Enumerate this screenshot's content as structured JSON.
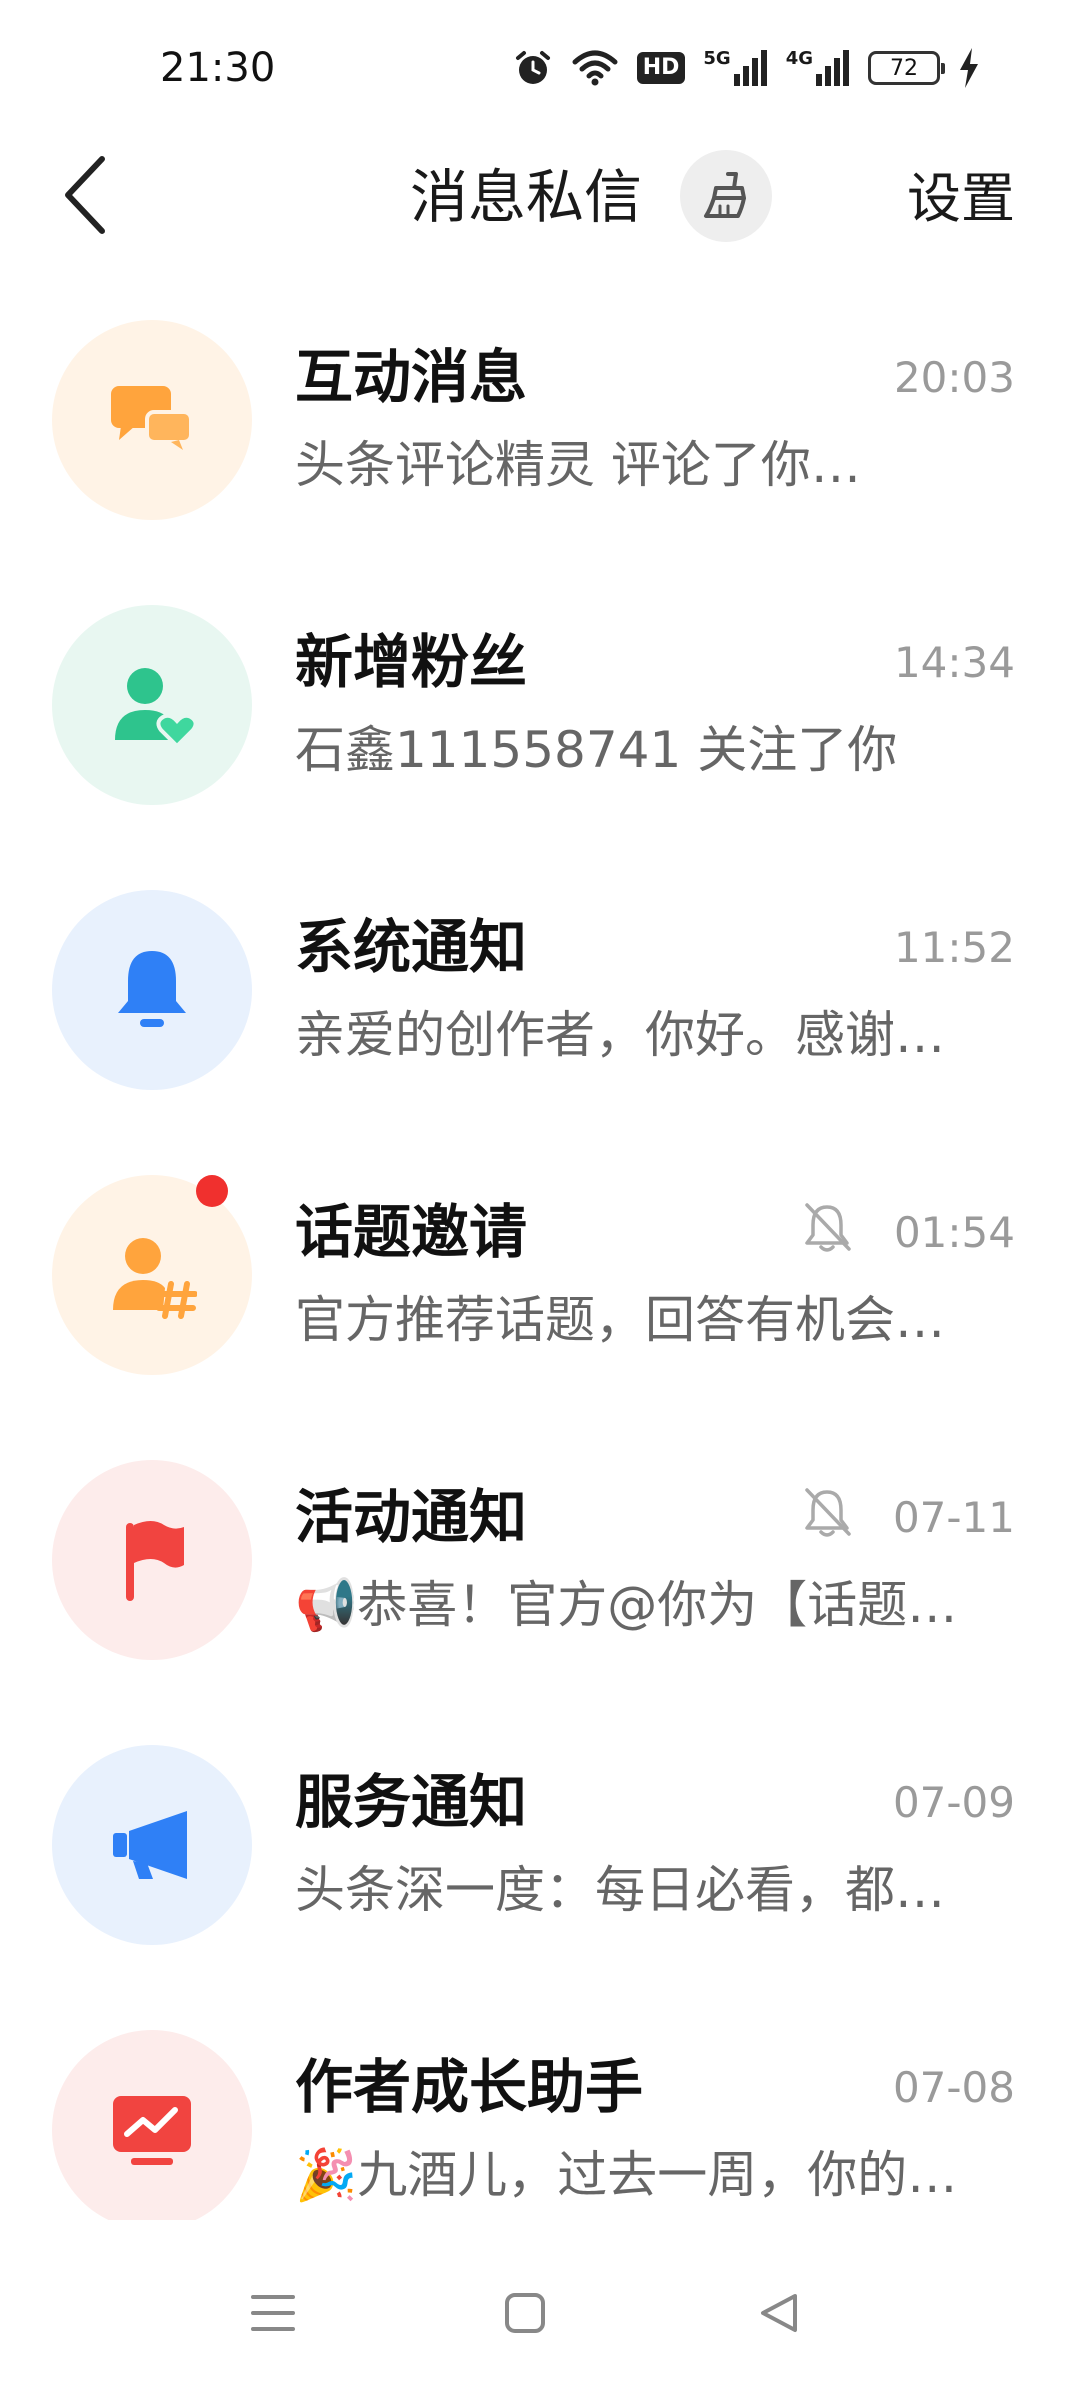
{
  "status_bar": {
    "time": "21:30",
    "hd_label": "HD",
    "net1_label": "5G",
    "net2_label": "4G",
    "battery": "72"
  },
  "header": {
    "title": "消息私信",
    "settings_label": "设置"
  },
  "items": [
    {
      "title": "互动消息",
      "preview": "头条评论精灵 评论了你…",
      "time": "20:03",
      "icon": "chat-bubbles-icon",
      "bg": "#fff3e6",
      "color": "#ffa43d"
    },
    {
      "title": "新增粉丝",
      "preview": "石鑫111558741 关注了你",
      "time": "14:34",
      "icon": "person-heart-icon",
      "bg": "#e8f7f1",
      "color": "#2ec48d"
    },
    {
      "title": "系统通知",
      "preview": "亲爱的创作者，你好。感谢…",
      "time": "11:52",
      "icon": "bell-icon",
      "bg": "#e8f1fd",
      "color": "#2f80f6"
    },
    {
      "title": "话题邀请",
      "preview": "官方推荐话题，回答有机会…",
      "time": "01:54",
      "icon": "person-hashtag-icon",
      "bg": "#fff3e6",
      "color": "#ffa43d",
      "muted": true,
      "unread": true
    },
    {
      "title": "活动通知",
      "preview": "📢恭喜！官方@你为【话题…",
      "time": "07-11",
      "icon": "flag-icon",
      "bg": "#fdeceb",
      "color": "#f14440",
      "muted": true
    },
    {
      "title": "服务通知",
      "preview": "头条深一度：每日必看，都…",
      "time": "07-09",
      "icon": "megaphone-icon",
      "bg": "#e8f1fd",
      "color": "#2f80f6"
    },
    {
      "title": "作者成长助手",
      "preview": "🎉九酒儿，过去一周，你的…",
      "time": "07-08",
      "icon": "trend-chart-icon",
      "bg": "#fdeceb",
      "color": "#f14440"
    }
  ],
  "colors": {
    "unread_dot": "#f0302e",
    "secondary_text": "#666666",
    "time_text": "#9a9a9a"
  }
}
